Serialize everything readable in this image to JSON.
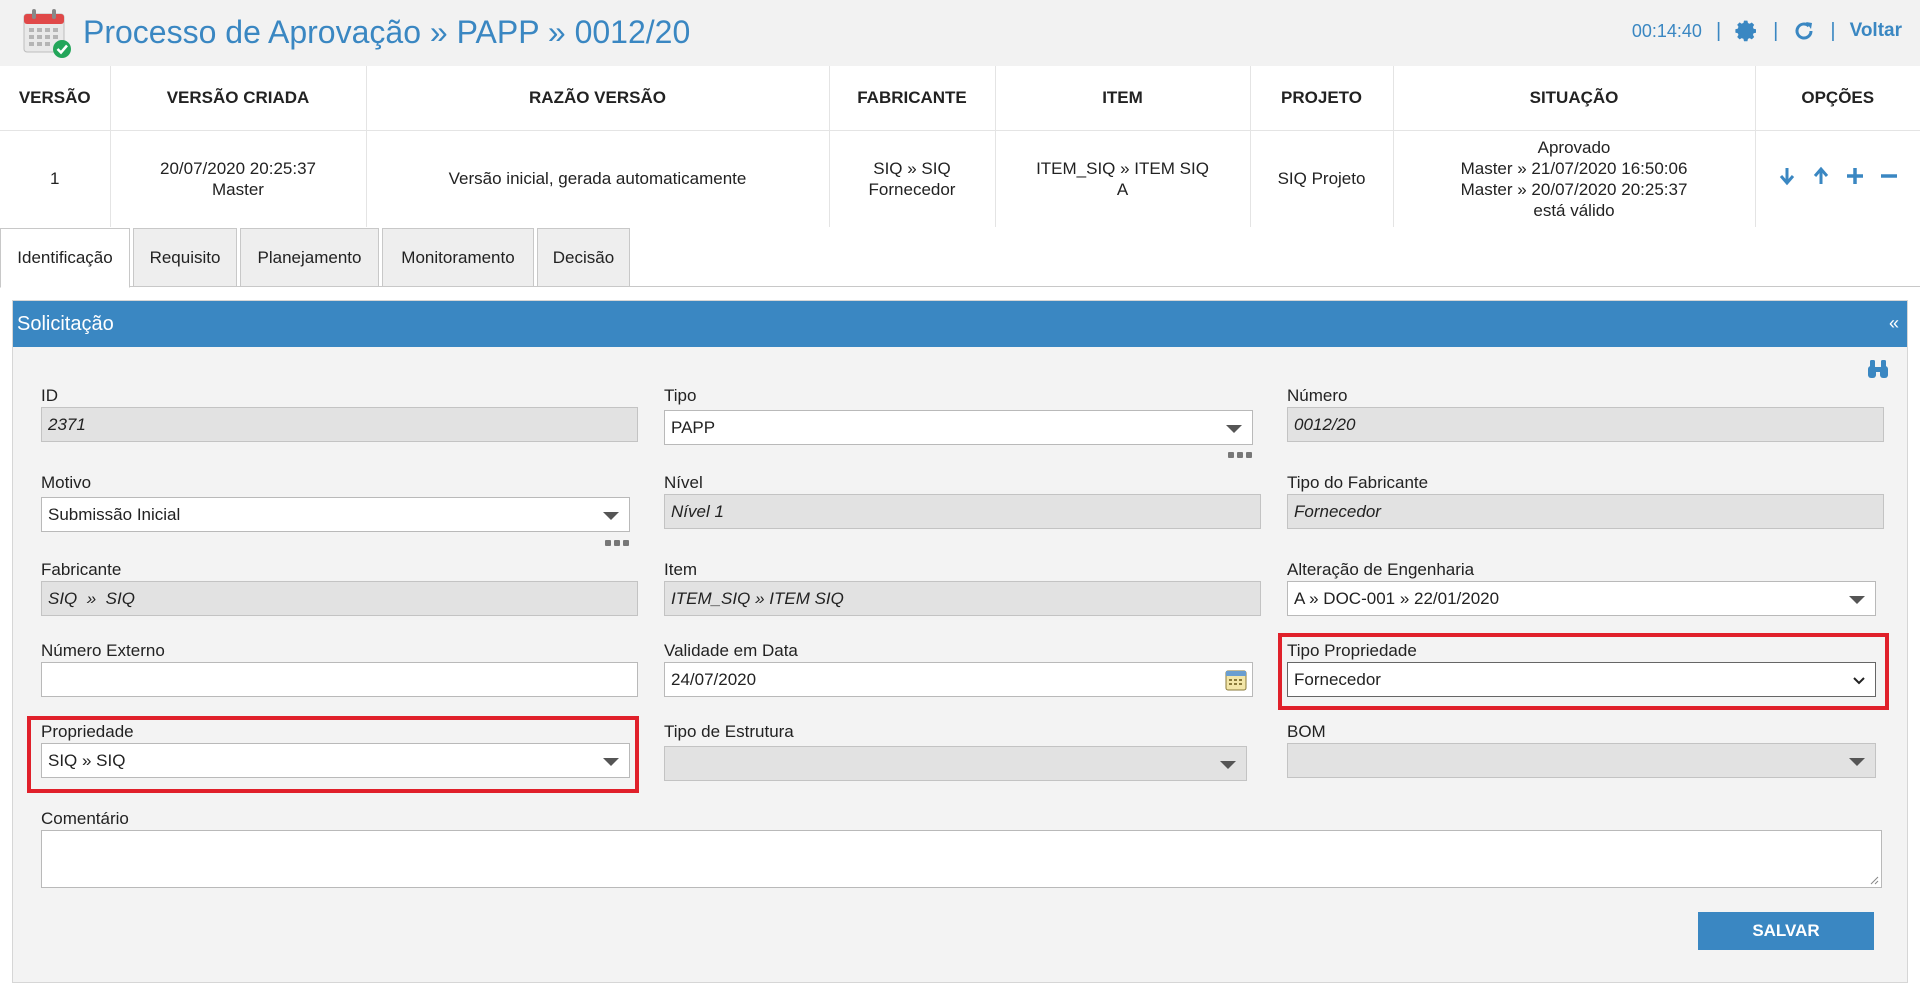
{
  "header": {
    "title": "Processo de Aprovação » PAPP » 0012/20",
    "timer": "00:14:40",
    "separator": "|",
    "back_label": "Voltar"
  },
  "versions": {
    "columns": [
      "VERSÃO",
      "VERSÃO CRIADA",
      "RAZÃO VERSÃO",
      "FABRICANTE",
      "ITEM",
      "PROJETO",
      "SITUAÇÃO",
      "OPÇÕES"
    ],
    "row": {
      "version": "1",
      "created_date": "20/07/2020 20:25:37",
      "created_by": "Master",
      "reason": "Versão inicial, gerada automaticamente",
      "manufacturer_line1": "SIQ » SIQ",
      "manufacturer_line2": "Fornecedor",
      "item_line1": "ITEM_SIQ » ITEM SIQ",
      "item_line2": "A",
      "project": "SIQ Projeto",
      "status_line1": "Aprovado",
      "status_line2": "Master » 21/07/2020 16:50:06",
      "status_line3": "Master » 20/07/2020 20:25:37",
      "status_line4": "está válido",
      "option_icons": [
        "arrow-down-icon",
        "arrow-up-icon",
        "plus-icon",
        "minus-icon"
      ]
    }
  },
  "tabs": [
    {
      "label": "Identificação",
      "active": true
    },
    {
      "label": "Requisito",
      "active": false
    },
    {
      "label": "Planejamento",
      "active": false
    },
    {
      "label": "Monitoramento",
      "active": false
    },
    {
      "label": "Decisão",
      "active": false
    }
  ],
  "section": {
    "title": "Solicitação",
    "collapse_glyph": "«"
  },
  "form": {
    "id": {
      "label": "ID",
      "value": "2371"
    },
    "tipo": {
      "label": "Tipo",
      "value": "PAPP"
    },
    "numero": {
      "label": "Número",
      "value": "0012/20"
    },
    "motivo": {
      "label": "Motivo",
      "value": "Submissão Inicial"
    },
    "nivel": {
      "label": "Nível",
      "value": "Nível 1"
    },
    "tipo_fabricante": {
      "label": "Tipo do Fabricante",
      "value": "Fornecedor"
    },
    "fabricante": {
      "label": "Fabricante",
      "value": "SIQ  »  SIQ"
    },
    "item": {
      "label": "Item",
      "value": "ITEM_SIQ » ITEM SIQ"
    },
    "alteracao": {
      "label": "Alteração de Engenharia",
      "value": "A » DOC-001 » 22/01/2020"
    },
    "numero_externo": {
      "label": "Número Externo",
      "value": ""
    },
    "validade": {
      "label": "Validade em Data",
      "value": "24/07/2020"
    },
    "tipo_propriedade": {
      "label": "Tipo Propriedade",
      "value": "Fornecedor"
    },
    "propriedade": {
      "label": "Propriedade",
      "value": "SIQ » SIQ"
    },
    "tipo_estrutura": {
      "label": "Tipo de Estrutura",
      "value": ""
    },
    "bom": {
      "label": "BOM",
      "value": ""
    },
    "comentario": {
      "label": "Comentário",
      "value": ""
    }
  },
  "actions": {
    "save_label": "SALVAR"
  },
  "colors": {
    "accent": "#3a87c2",
    "highlight": "#e0202a",
    "readonly_bg": "#e2e2e2"
  }
}
